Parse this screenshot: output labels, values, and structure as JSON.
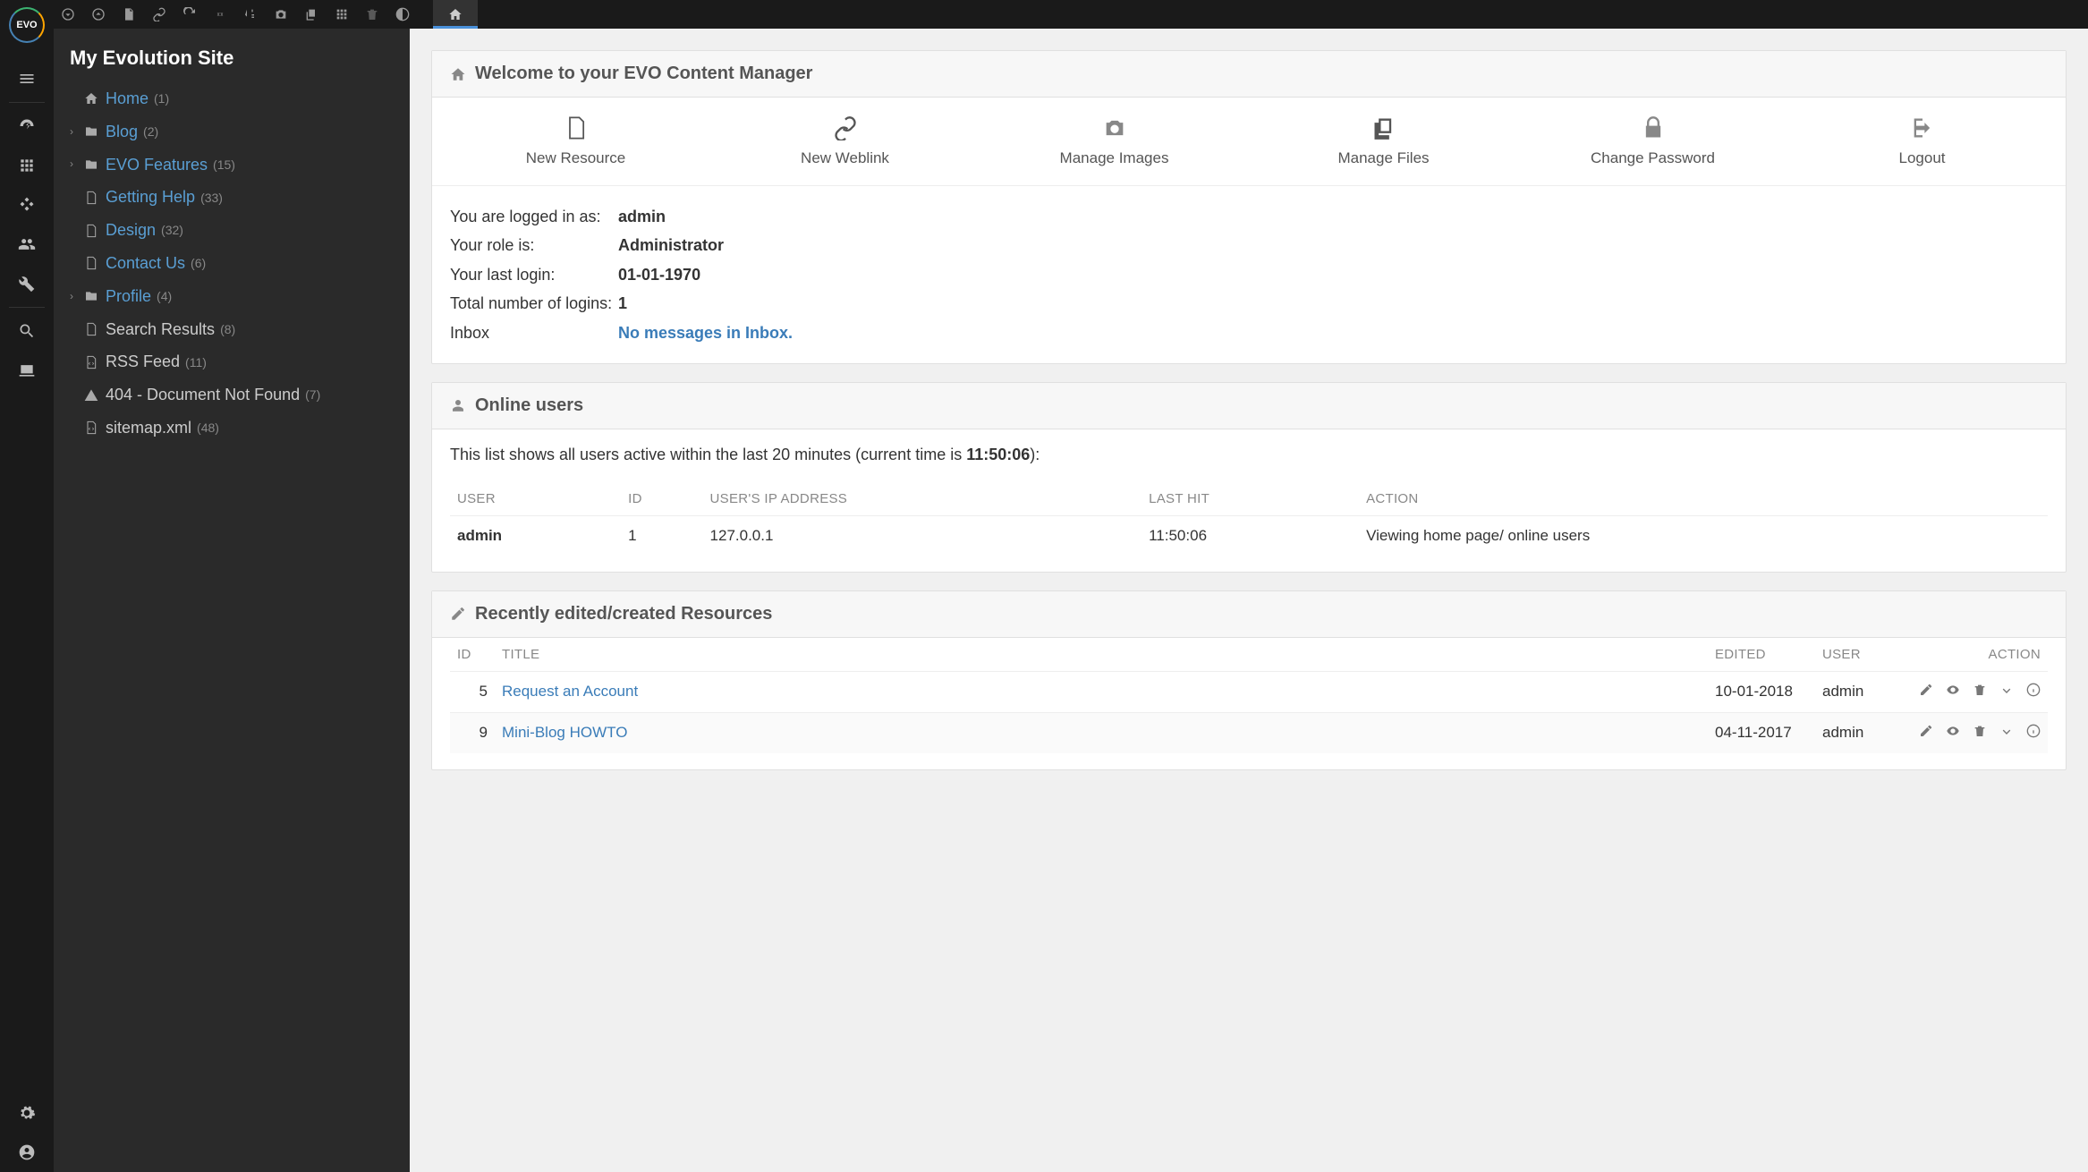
{
  "site_title": "My Evolution Site",
  "logo_text": "EVO",
  "tree": [
    {
      "icon": "home",
      "label": "Home",
      "count": "(1)",
      "link": true,
      "expand": false
    },
    {
      "icon": "folder",
      "label": "Blog",
      "count": "(2)",
      "link": true,
      "expand": true
    },
    {
      "icon": "folder",
      "label": "EVO Features",
      "count": "(15)",
      "link": true,
      "expand": true
    },
    {
      "icon": "file",
      "label": "Getting Help",
      "count": "(33)",
      "link": true,
      "expand": false
    },
    {
      "icon": "file",
      "label": "Design",
      "count": "(32)",
      "link": true,
      "expand": false
    },
    {
      "icon": "file",
      "label": "Contact Us",
      "count": "(6)",
      "link": true,
      "expand": false
    },
    {
      "icon": "folder",
      "label": "Profile",
      "count": "(4)",
      "link": true,
      "expand": true
    },
    {
      "icon": "file",
      "label": "Search Results",
      "count": "(8)",
      "link": false,
      "expand": false
    },
    {
      "icon": "code",
      "label": "RSS Feed",
      "count": "(11)",
      "link": false,
      "expand": false
    },
    {
      "icon": "warn",
      "label": "404 - Document Not Found",
      "count": "(7)",
      "link": false,
      "expand": false
    },
    {
      "icon": "code",
      "label": "sitemap.xml",
      "count": "(48)",
      "link": false,
      "expand": false
    }
  ],
  "welcome_title": "Welcome to your EVO Content Manager",
  "actions": [
    {
      "label": "New Resource",
      "icon": "file"
    },
    {
      "label": "New Weblink",
      "icon": "link"
    },
    {
      "label": "Manage Images",
      "icon": "camera"
    },
    {
      "label": "Manage Files",
      "icon": "files"
    },
    {
      "label": "Change Password",
      "icon": "lock"
    },
    {
      "label": "Logout",
      "icon": "logout"
    }
  ],
  "info": {
    "logged_in_label": "You are logged in as:",
    "logged_in_value": "admin",
    "role_label": "Your role is:",
    "role_value": "Administrator",
    "last_login_label": "Your last login:",
    "last_login_value": "01-01-1970",
    "total_logins_label": "Total number of logins:",
    "total_logins_value": "1",
    "inbox_label": "Inbox",
    "inbox_value": "No messages in Inbox."
  },
  "online": {
    "title": "Online users",
    "desc_prefix": "This list shows all users active within the last 20 minutes (current time is ",
    "current_time": "11:50:06",
    "desc_suffix": "):",
    "columns": {
      "user": "USER",
      "id": "ID",
      "ip": "USER'S IP ADDRESS",
      "last_hit": "LAST HIT",
      "action": "ACTION"
    },
    "rows": [
      {
        "user": "admin",
        "id": "1",
        "ip": "127.0.0.1",
        "last_hit": "11:50:06",
        "action": "Viewing home page/ online users"
      }
    ]
  },
  "recent": {
    "title": "Recently edited/created Resources",
    "columns": {
      "id": "ID",
      "title": "TITLE",
      "edited": "EDITED",
      "user": "USER",
      "action": "ACTION"
    },
    "rows": [
      {
        "id": "5",
        "title": "Request an Account",
        "edited": "10-01-2018",
        "user": "admin"
      },
      {
        "id": "9",
        "title": "Mini-Blog HOWTO",
        "edited": "04-11-2017",
        "user": "admin"
      }
    ]
  }
}
